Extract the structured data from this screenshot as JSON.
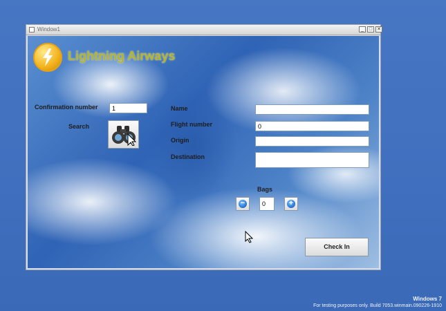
{
  "window": {
    "title": "Window1",
    "controls": {
      "minimize": "_",
      "maximize": "□",
      "close": "✕"
    }
  },
  "brand": {
    "name": "Lightning Airways",
    "logo_icon": "lightning-bolt-icon",
    "color": "#b8b51a"
  },
  "booking_lookup": {
    "confirmation_label": "Confirmation number",
    "confirmation_value": "1",
    "search_label": "Search",
    "search_icon": "binoculars-icon"
  },
  "passenger": {
    "name_label": "Name",
    "name_value": "",
    "flight_label": "Flight number",
    "flight_value": "0",
    "origin_label": "Origin",
    "origin_value": "",
    "destination_label": "Destination",
    "destination_value": ""
  },
  "bags": {
    "label": "Bags",
    "value": "0",
    "decrement_icon": "minus-icon",
    "increment_icon": "plus-icon"
  },
  "actions": {
    "checkin_label": "Check In"
  },
  "desktop": {
    "os_name": "Windows 7",
    "build_notice": "For testing purposes only. Build 7053.winmain.090226-1910"
  }
}
